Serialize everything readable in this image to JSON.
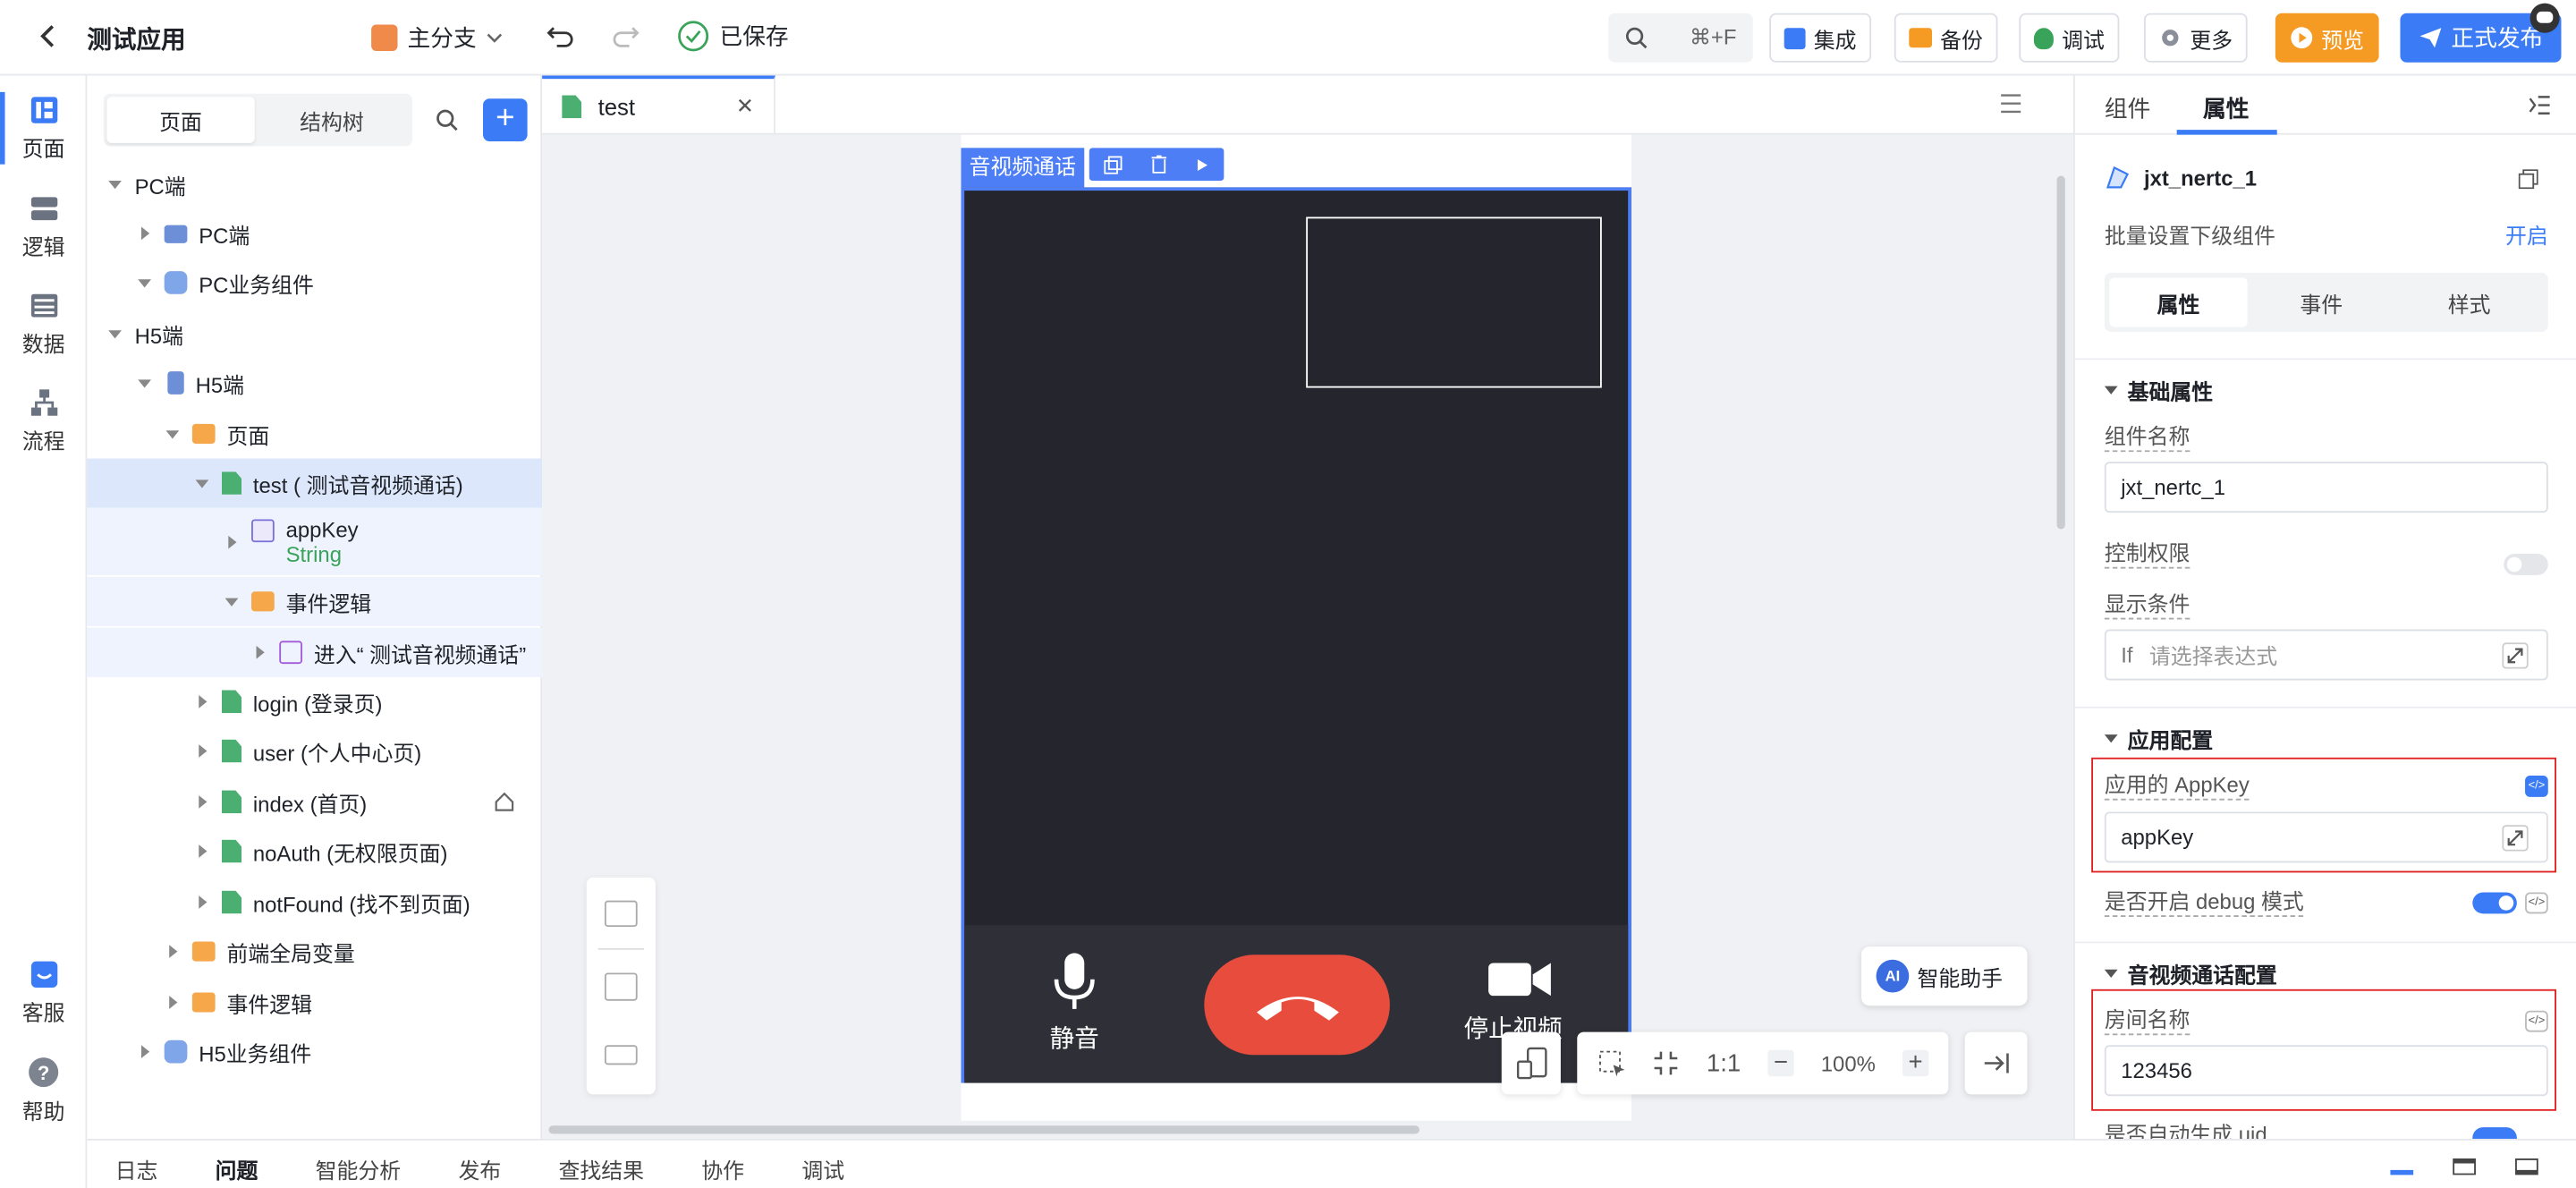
{
  "header": {
    "app_title": "测试应用",
    "branch": "主分支",
    "saved": "已保存",
    "shortcut": "⌘+F",
    "integrate": "集成",
    "backup": "备份",
    "debug": "调试",
    "more": "更多",
    "preview": "预览",
    "publish": "正式发布"
  },
  "rail": {
    "items": [
      {
        "label": "页面",
        "icon": "page-layout-icon"
      },
      {
        "label": "逻辑",
        "icon": "logic-icon"
      },
      {
        "label": "数据",
        "icon": "data-icon"
      },
      {
        "label": "流程",
        "icon": "flow-icon"
      }
    ],
    "service": "客服",
    "help": "帮助"
  },
  "tree": {
    "tab_page": "页面",
    "tab_structure": "结构树",
    "nodes": [
      {
        "label": "PC端"
      },
      {
        "label": "PC端"
      },
      {
        "label": "PC业务组件"
      },
      {
        "label": "H5端"
      },
      {
        "label": "H5端"
      },
      {
        "label": "页面"
      },
      {
        "label": "test ( 测试音视频通话)"
      },
      {
        "label": "appKey",
        "sub": "String"
      },
      {
        "label": "事件逻辑"
      },
      {
        "label": "进入“ 测试音视频通话”"
      },
      {
        "label": "login (登录页)"
      },
      {
        "label": "user (个人中心页)"
      },
      {
        "label": "index (首页)"
      },
      {
        "label": "noAuth (无权限页面)"
      },
      {
        "label": "notFound (找不到页面)"
      },
      {
        "label": "前端全局变量"
      },
      {
        "label": "事件逻辑"
      },
      {
        "label": "H5业务组件"
      }
    ]
  },
  "editor": {
    "tab": "test",
    "component_label": "音视频通话",
    "mute": "静音",
    "stop_video": "停止视频",
    "ai_assistant": "智能助手",
    "zoom": "100%",
    "ratio": "1:1"
  },
  "props": {
    "tab_components": "组件",
    "tab_attributes": "属性",
    "component_id": "jxt_nertc_1",
    "batch_set": "批量设置下级组件",
    "batch_open": "开启",
    "seg_attr": "属性",
    "seg_event": "事件",
    "seg_style": "样式",
    "sec_basic": "基础属性",
    "name_label": "组件名称",
    "name_value": "jxt_nertc_1",
    "perm_label": "控制权限",
    "cond_label": "显示条件",
    "cond_if": "If",
    "cond_placeholder": "请选择表达式",
    "sec_app": "应用配置",
    "appkey_label": "应用的 AppKey",
    "appkey_value": "appKey",
    "debug_label": "是否开启 debug 模式",
    "sec_av": "音视频通话配置",
    "room_label": "房间名称",
    "room_value": "123456",
    "uid_label": "是否自动生成 uid"
  },
  "bottom": {
    "tabs": [
      "日志",
      "问题",
      "智能分析",
      "发布",
      "查找结果",
      "协作",
      "调试"
    ]
  },
  "colors": {
    "primary": "#3b7cf6",
    "preview": "#f59a23",
    "hangup": "#e84c3d",
    "highlight": "#e02020",
    "video_bg": "#25262d"
  }
}
